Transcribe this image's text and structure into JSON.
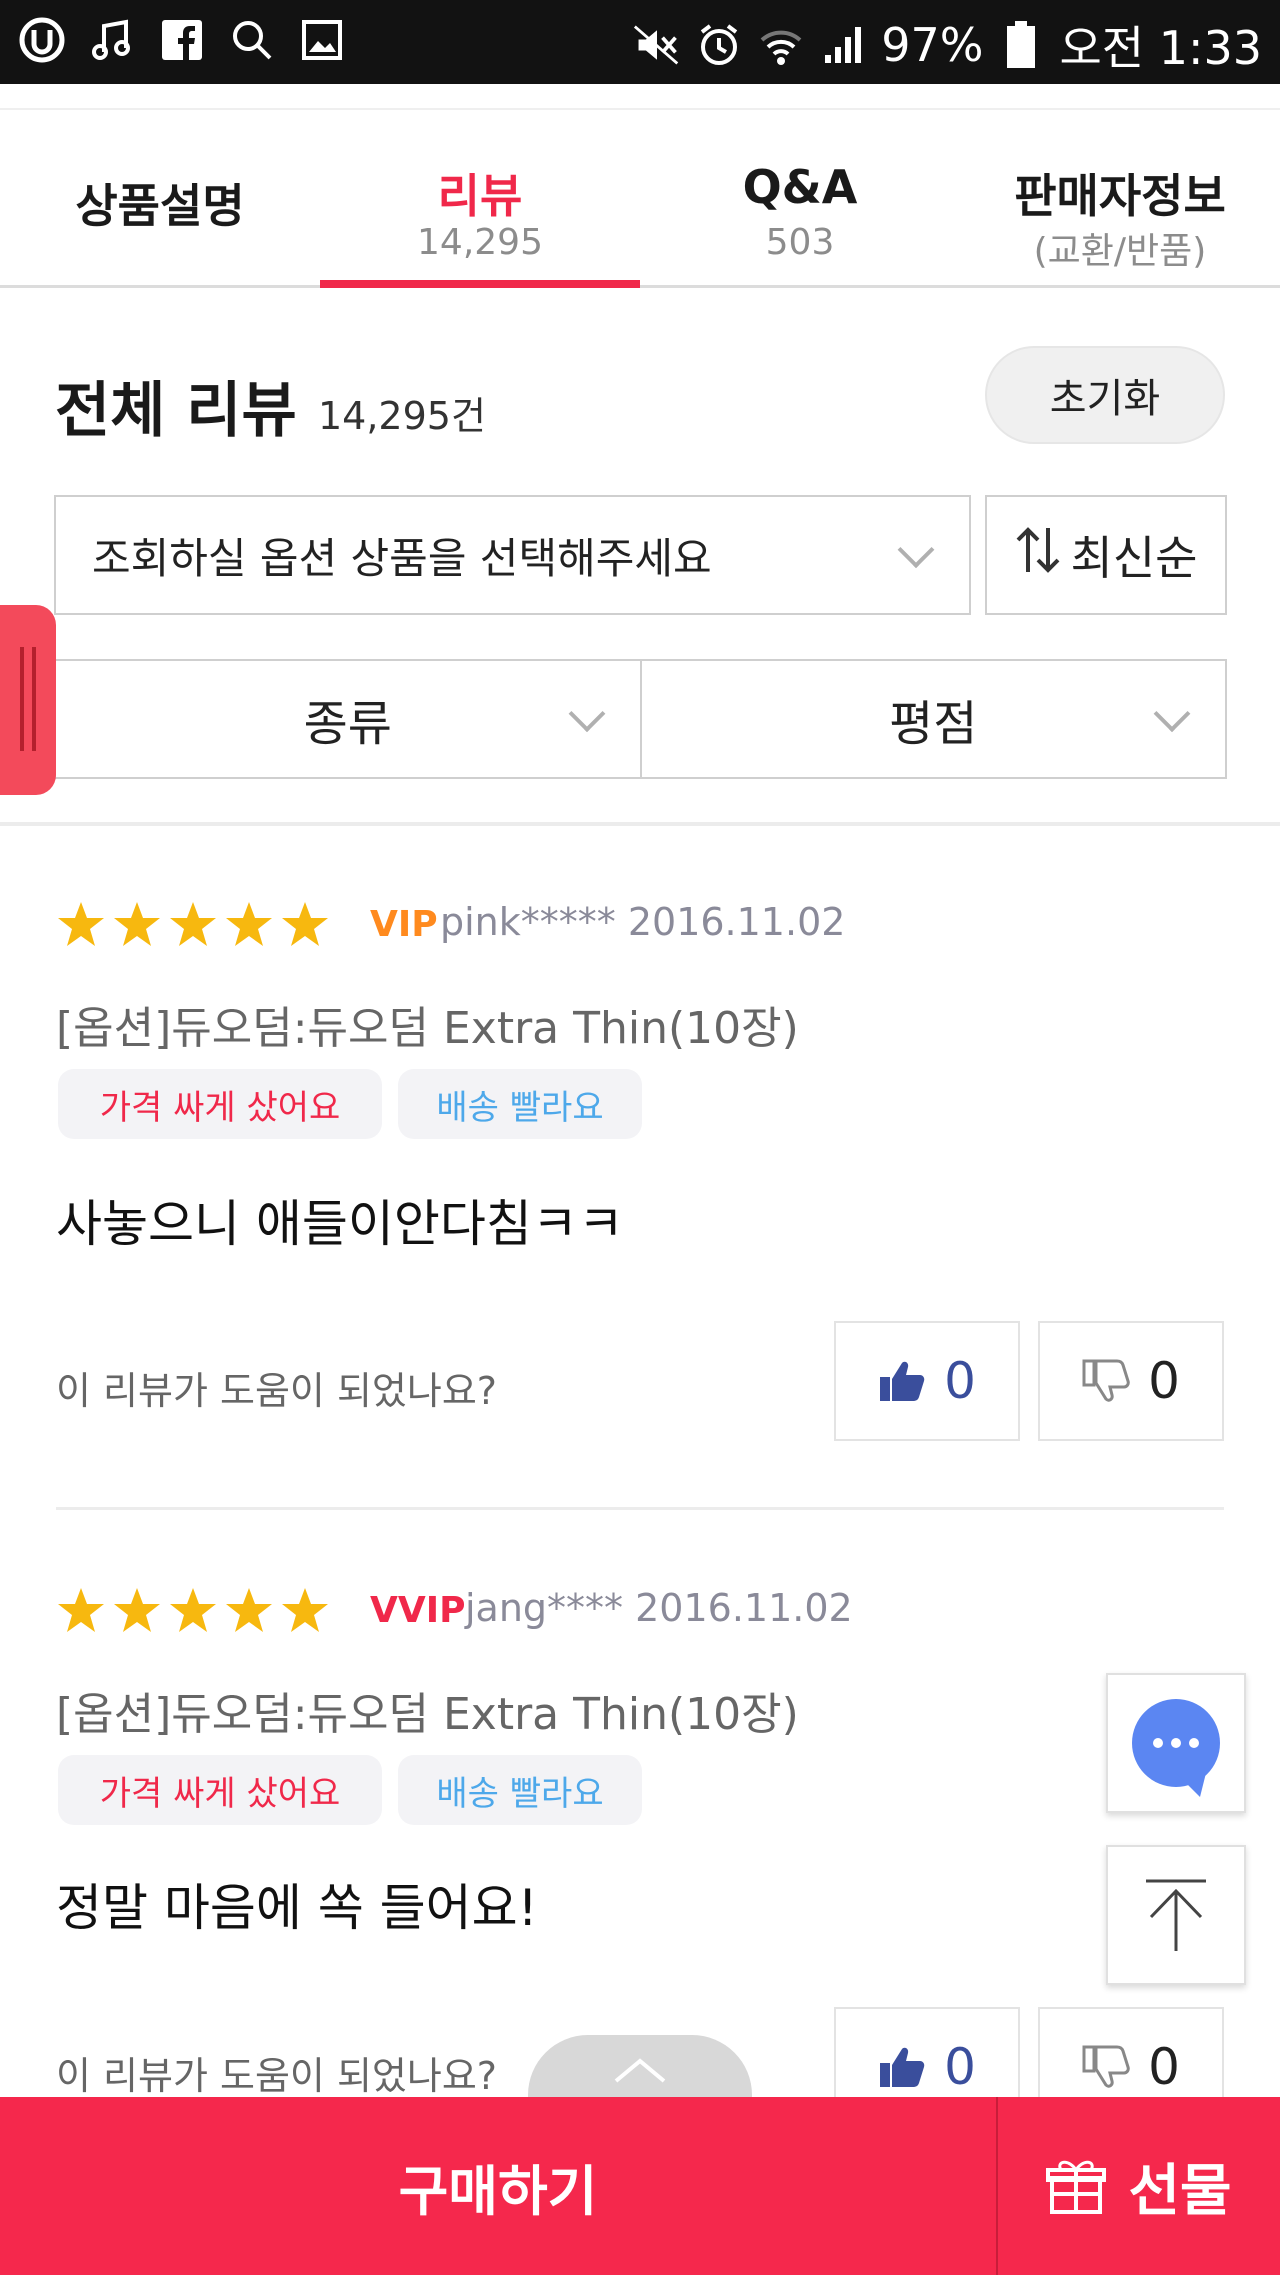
{
  "status_bar": {
    "battery": "97%",
    "time": "오전 1:33",
    "icons": [
      "u-plus-icon",
      "music-icon",
      "facebook-icon",
      "search-icon",
      "image-icon",
      "mute-icon",
      "alarm-icon",
      "wifi-icon",
      "signal-icon",
      "battery-icon"
    ]
  },
  "tabs": [
    {
      "label": "상품설명",
      "sub": ""
    },
    {
      "label": "리뷰",
      "sub": "14,295"
    },
    {
      "label": "Q&A",
      "sub": "503"
    },
    {
      "label": "판매자정보",
      "sub": "(교환/반품)"
    }
  ],
  "reviews_header": {
    "title": "전체 리뷰",
    "count": "14,295건",
    "reset": "초기화",
    "option_placeholder": "조회하실 옵션 상품을 선택해주세요",
    "sort": "최신순",
    "filter_type": "종류",
    "filter_rating": "평점"
  },
  "reviews": [
    {
      "rating": 5,
      "grade": "VIP",
      "user": "pink***** 2016.11.02",
      "option": "[옵션]듀오덤:듀오덤 Extra Thin(10장)",
      "tags": [
        "가격 싸게 샀어요",
        "배송 빨라요"
      ],
      "text": "사놓으니 애들이안다침ㅋㅋ",
      "helpful_question": "이 리뷰가 도움이 되었나요?",
      "likes": "0",
      "dislikes": "0"
    },
    {
      "rating": 5,
      "grade": "VVIP",
      "user": "jang**** 2016.11.02",
      "option": "[옵션]듀오덤:듀오덤 Extra Thin(10장)",
      "tags": [
        "가격 싸게 샀어요",
        "배송 빨라요"
      ],
      "text": "정말 마음에 쏙 들어요!",
      "helpful_question": "이 리뷰가 도움이 되었나요?",
      "likes": "0",
      "dislikes": "0"
    }
  ],
  "bottom_bar": {
    "buy": "구매하기",
    "gift": "선물"
  },
  "colors": {
    "accent": "#f0284a",
    "bottom_bar": "#f5284c",
    "star": "#f7b80f",
    "chat": "#5b86f2"
  }
}
